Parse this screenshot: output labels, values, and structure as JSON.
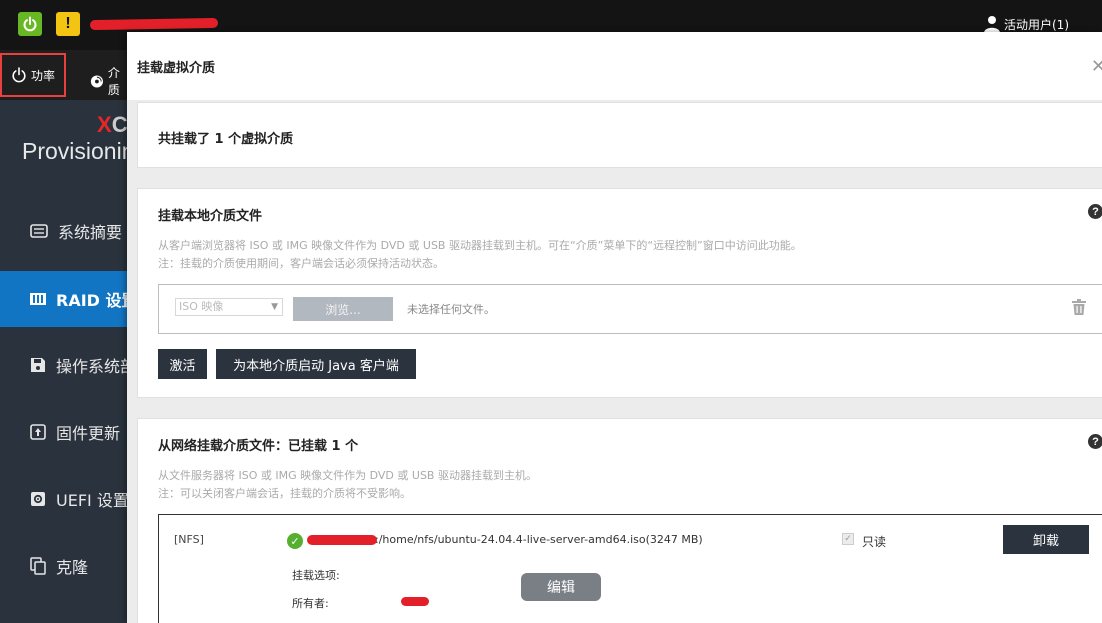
{
  "topbar": {
    "active_users": "活动用户(1)"
  },
  "toolbar": {
    "power_label": "功率",
    "media_label": "介质"
  },
  "sidebar": {
    "brand_partial": "XC",
    "brand_sub": "Provisioning",
    "items": [
      {
        "label": "系统摘要",
        "icon": "summary-icon"
      },
      {
        "label": "RAID 设置",
        "icon": "raid-icon",
        "selected": true
      },
      {
        "label": "操作系统部署",
        "icon": "save-icon"
      },
      {
        "label": "固件更新",
        "icon": "firmware-icon"
      },
      {
        "label": "UEFI 设置",
        "icon": "gear-icon"
      },
      {
        "label": "克隆",
        "icon": "clone-icon"
      }
    ]
  },
  "modal": {
    "title": "挂载虚拟介质",
    "summary": "共挂载了 1 个虚拟介质",
    "local": {
      "title": "挂载本地介质文件",
      "hint1": "从客户端浏览器将 ISO 或 IMG 映像文件作为 DVD 或 USB 驱动器挂载到主机。可在“介质”菜单下的“远程控制”窗口中访问此功能。",
      "hint2": "注：挂载的介质使用期间，客户端会话必须保持活动状态。",
      "select_value": "ISO 映像",
      "browse_label": "浏览...",
      "no_file": "未选择任何文件。",
      "activate_label": "激活",
      "java_label": "为本地介质启动 Java 客户端"
    },
    "network": {
      "title": "从网络挂载介质文件：已挂载 1 个",
      "hint1": "从文件服务器将 ISO 或 IMG 映像文件作为 DVD 或 USB 驱动器挂载到主机。",
      "hint2": "注：可以关闭客户端会话，挂载的介质将不受影响。",
      "entry": {
        "protocol": "[NFS]",
        "path": ":/home/nfs/ubuntu-24.04.4-live-server-amd64.iso(3247 MB)",
        "readonly_label": "只读",
        "readonly_checked": true,
        "unmount_label": "卸载",
        "options_label": "挂载选项:",
        "owner_label": "所有者:",
        "edit_label": "编辑"
      }
    }
  },
  "colors": {
    "accent": "#1275c4",
    "sidebar_bg": "#2a323d",
    "dark_button": "#2b333e",
    "power_green": "#67b823",
    "warning_yellow": "#f3c412",
    "highlight_red": "#e94040"
  }
}
